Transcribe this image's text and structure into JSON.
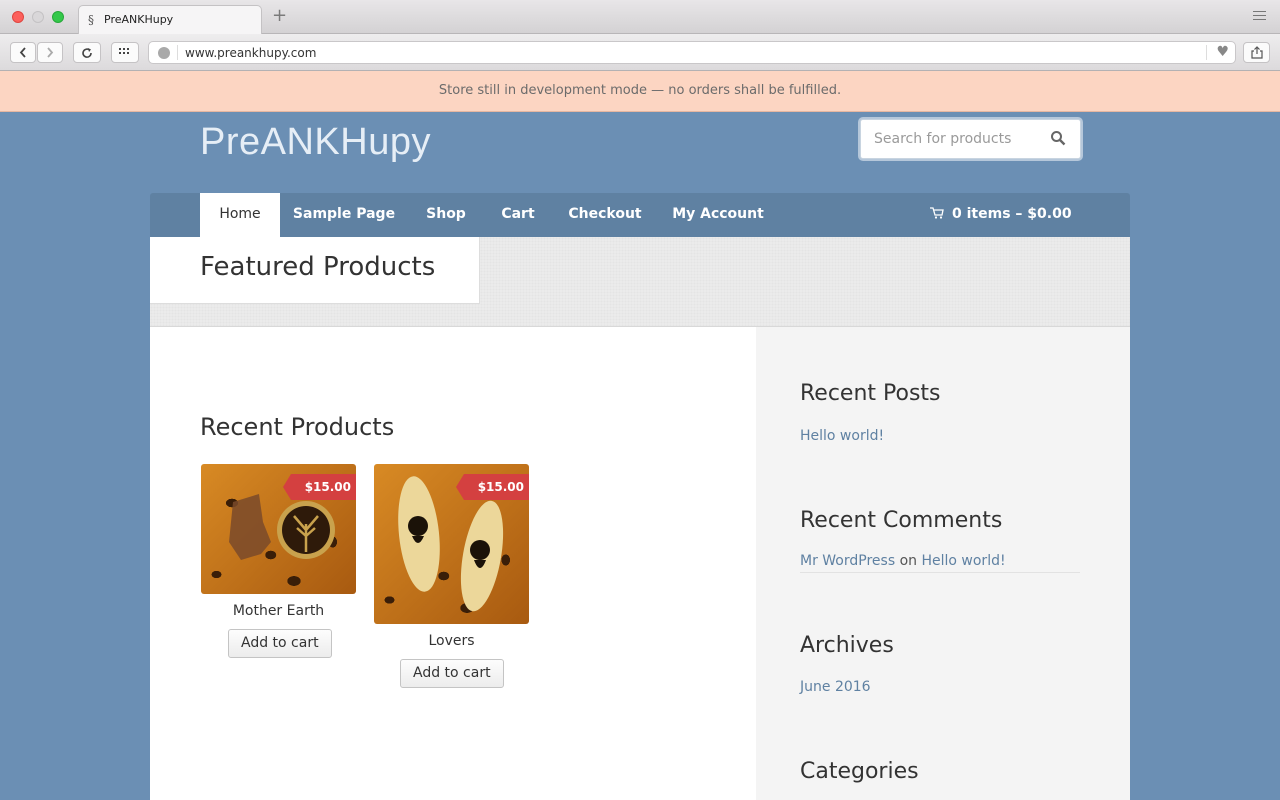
{
  "browser": {
    "tab_title": "PreANKHupy",
    "tab_favicon": "§",
    "new_tab": "+",
    "url": "www.preankhupy.com",
    "icons": [
      "back-icon",
      "forward-icon",
      "reload-icon",
      "grid-icon",
      "globe-icon",
      "heart-icon",
      "share-icon"
    ]
  },
  "notice": "Store still in development mode — no orders shall be fulfilled.",
  "site": {
    "title": "PreANKHupy"
  },
  "search": {
    "placeholder": "Search for products"
  },
  "nav": {
    "items": [
      {
        "label": "Home",
        "active": true
      },
      {
        "label": "Sample Page"
      },
      {
        "label": "Shop"
      },
      {
        "label": "Cart"
      },
      {
        "label": "Checkout"
      },
      {
        "label": "My Account"
      }
    ],
    "cart": "0 items – $0.00"
  },
  "featured": {
    "title": "Featured Products"
  },
  "recent_products": {
    "title": "Recent Products",
    "products": [
      {
        "name": "Mother Earth",
        "price": "$15.00",
        "button": "Add to cart"
      },
      {
        "name": "Lovers",
        "price": "$15.00",
        "button": "Add to cart"
      }
    ]
  },
  "sidebar": {
    "recent_posts": {
      "title": "Recent Posts",
      "items": [
        "Hello world!"
      ]
    },
    "recent_comments": {
      "title": "Recent Comments",
      "author": "Mr WordPress",
      "on": "on",
      "post": "Hello world!"
    },
    "archives": {
      "title": "Archives",
      "items": [
        "June 2016"
      ]
    },
    "categories": {
      "title": "Categories"
    }
  },
  "colors": {
    "page_bg": "#6b8fb4",
    "nav_bg": "#5f81a2",
    "notice_bg": "#fcd5c2",
    "price_tag": "#d44040",
    "link": "#5f81a2"
  }
}
